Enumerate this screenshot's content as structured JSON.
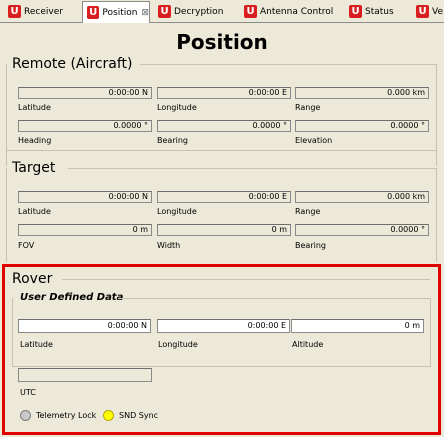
{
  "tabs": [
    {
      "label": "Receiver"
    },
    {
      "label": "Position",
      "close": "⊠"
    },
    {
      "label": "Decryption"
    },
    {
      "label": "Antenna Control"
    },
    {
      "label": "Status"
    },
    {
      "label": "Ve"
    }
  ],
  "page_title": "Position",
  "remote": {
    "title": "Remote (Aircraft)",
    "latitude": {
      "label": "Latitude",
      "value": "0:00:00 N"
    },
    "longitude": {
      "label": "Longitude",
      "value": "0:00:00 E"
    },
    "range": {
      "label": "Range",
      "value": "0.000 km"
    },
    "heading": {
      "label": "Heading",
      "value": "0.0000 °"
    },
    "bearing": {
      "label": "Bearing",
      "value": "0.0000 °"
    },
    "elevation": {
      "label": "Elevation",
      "value": "0.0000 °"
    }
  },
  "target": {
    "title": "Target",
    "latitude": {
      "label": "Latitude",
      "value": "0:00:00 N"
    },
    "longitude": {
      "label": "Longitude",
      "value": "0:00:00 E"
    },
    "range": {
      "label": "Range",
      "value": "0.000 km"
    },
    "fov": {
      "label": "FOV",
      "value": "0 m"
    },
    "width": {
      "label": "Width",
      "value": "0 m"
    },
    "bearing": {
      "label": "Bearing",
      "value": "0.0000 °"
    }
  },
  "rover": {
    "title": "Rover",
    "user_defined_title": "User Defined Data",
    "latitude": {
      "label": "Latitude",
      "value": "0:00:00 N"
    },
    "longitude": {
      "label": "Longitude",
      "value": "0:00:00 E"
    },
    "altitude": {
      "label": "Altitude",
      "value": "0 m"
    },
    "utc": {
      "label": "UTC",
      "value": ""
    },
    "telemetry_lock": {
      "label": "Telemetry Lock",
      "color": "#c9c9c9"
    },
    "snd_sync": {
      "label": "SND Sync",
      "color": "#ffff00"
    }
  },
  "colors": {
    "highlight": "#e10000",
    "tab_icon": "#d81e1e"
  }
}
